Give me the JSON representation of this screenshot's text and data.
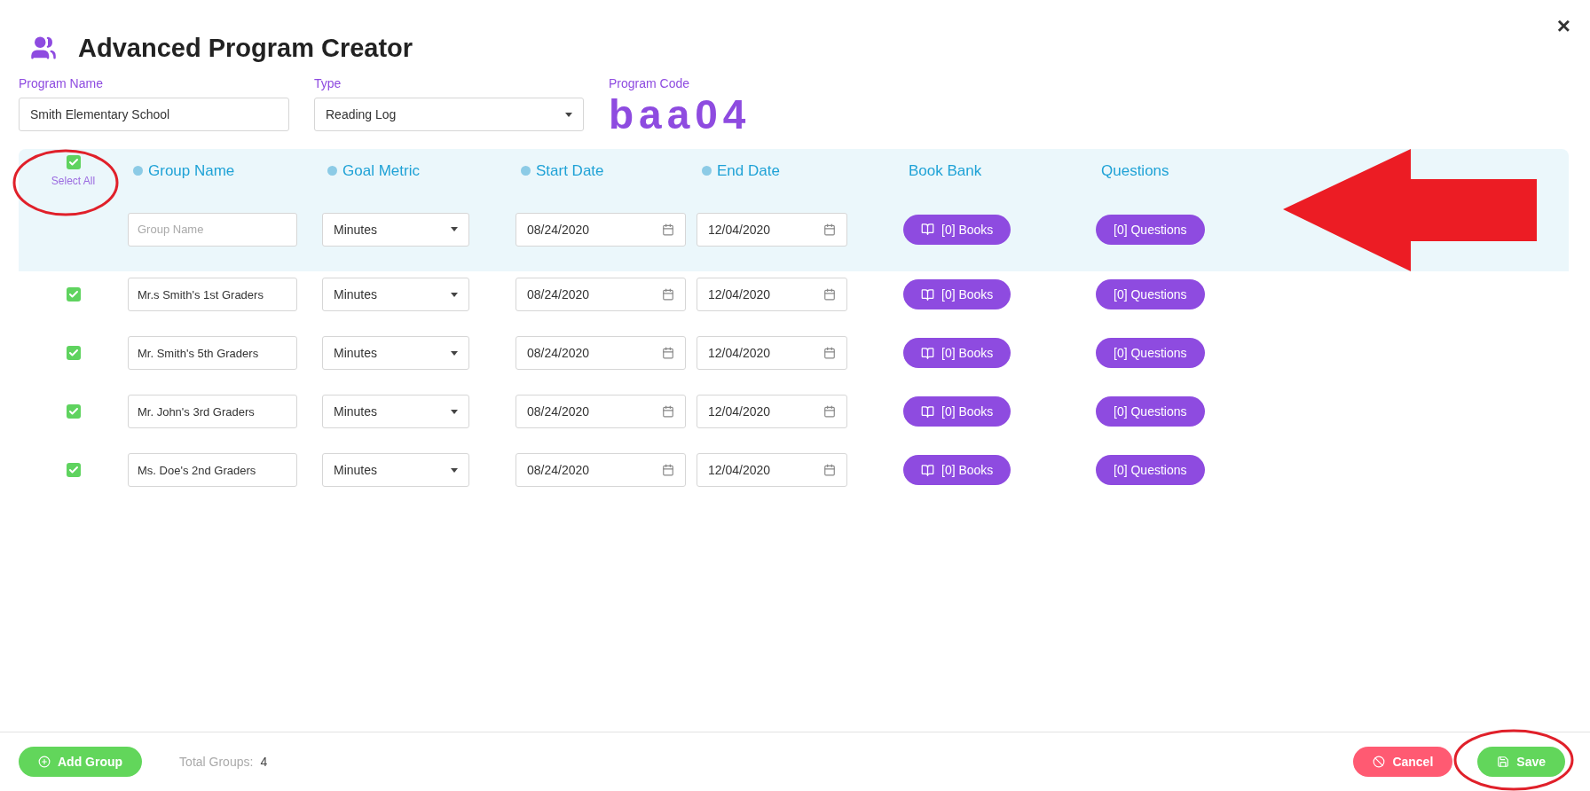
{
  "window": {
    "title": "Advanced Program Creator",
    "close": "×"
  },
  "program": {
    "name_label": "Program Name",
    "name_value": "Smith Elementary School",
    "type_label": "Type",
    "type_value": "Reading Log",
    "code_label": "Program Code",
    "code_value": "baa04"
  },
  "select_all": {
    "label": "Select All",
    "checked": true
  },
  "columns": [
    {
      "label": "Group Name",
      "help": true
    },
    {
      "label": "Goal Metric",
      "help": true
    },
    {
      "label": "Start Date",
      "help": true
    },
    {
      "label": "End Date",
      "help": true
    },
    {
      "label": "Book Bank",
      "help": false
    },
    {
      "label": "Questions",
      "help": false
    }
  ],
  "new_group": {
    "placeholder": "Group Name",
    "metric": "Minutes",
    "start": "08/24/2020",
    "end": "12/04/2020",
    "books": "[0] Books",
    "questions": "[0] Questions"
  },
  "rows": [
    {
      "checked": true,
      "name": "Mr.s Smith's 1st Graders",
      "metric": "Minutes",
      "start": "08/24/2020",
      "end": "12/04/2020",
      "books": "[0] Books",
      "questions": "[0] Questions"
    },
    {
      "checked": true,
      "name": "Mr. Smith's 5th Graders",
      "metric": "Minutes",
      "start": "08/24/2020",
      "end": "12/04/2020",
      "books": "[0] Books",
      "questions": "[0] Questions"
    },
    {
      "checked": true,
      "name": "Mr. John's 3rd Graders",
      "metric": "Minutes",
      "start": "08/24/2020",
      "end": "12/04/2020",
      "books": "[0] Books",
      "questions": "[0] Questions"
    },
    {
      "checked": true,
      "name": "Ms. Doe's 2nd Graders",
      "metric": "Minutes",
      "start": "08/24/2020",
      "end": "12/04/2020",
      "books": "[0] Books",
      "questions": "[0] Questions"
    }
  ],
  "footer": {
    "add": "Add Group",
    "total_label": "Total Groups:",
    "total": "4",
    "cancel": "Cancel",
    "save": "Save"
  }
}
